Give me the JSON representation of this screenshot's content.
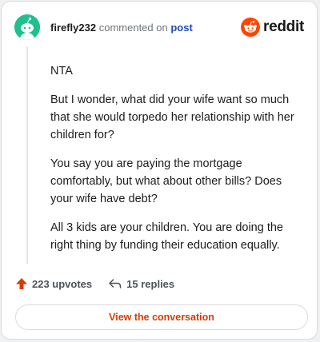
{
  "header": {
    "username": "firefly232",
    "action_text": "commented on",
    "post_link": "post",
    "logo_text": "reddit"
  },
  "comment": {
    "paragraphs": [
      "NTA",
      "But I wonder, what did your wife want so much that she would torpedo her relationship with her children for?",
      "You say you are paying the mortgage comfortably, but what about other bills? Does your wife have debt?",
      "All 3 kids are your children. You are doing the right thing by funding their education equally."
    ]
  },
  "actions": {
    "upvotes": "223 upvotes",
    "replies": "15 replies"
  },
  "cta": {
    "label": "View the conversation"
  },
  "colors": {
    "avatar_bg": "#1dc08e",
    "brand_orange": "#ff4500",
    "upvote_orange": "#d93a00",
    "link_blue": "#1f4bb5"
  },
  "icons": {
    "avatar": "snoo-avatar-icon",
    "logo": "reddit-snoo-icon",
    "upvote": "upvote-arrow-icon",
    "reply": "reply-arrow-icon"
  }
}
